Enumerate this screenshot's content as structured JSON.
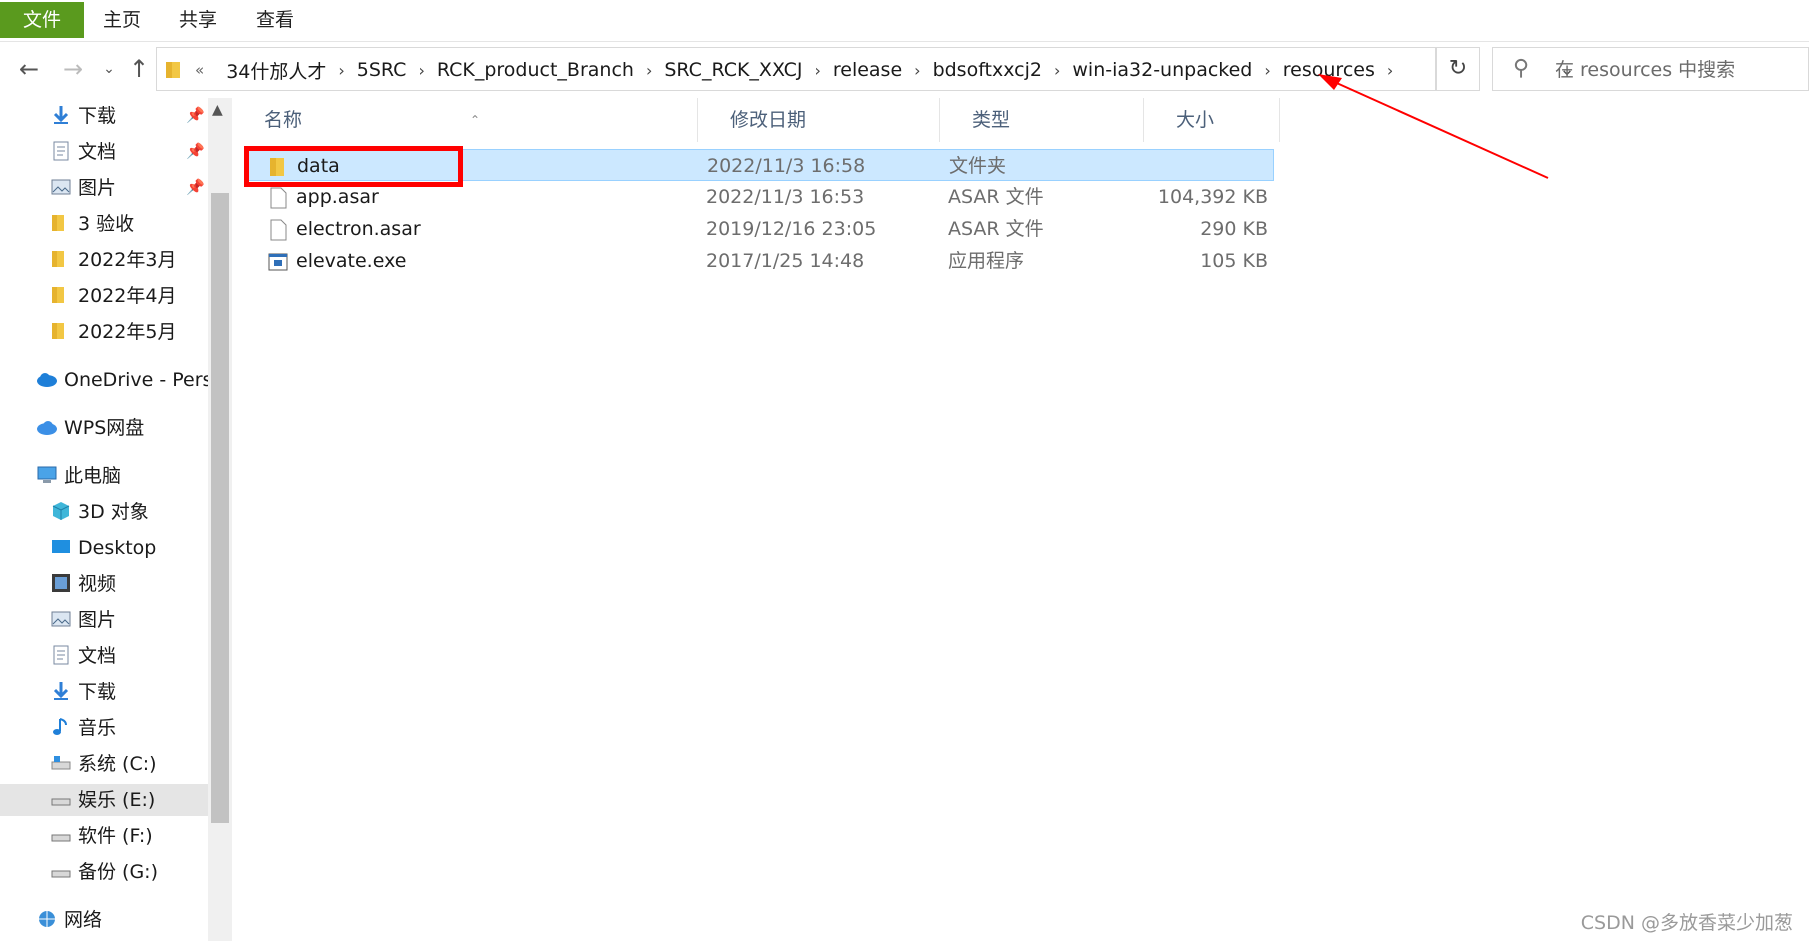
{
  "ribbon": {
    "tabs": [
      {
        "label": "文件"
      },
      {
        "label": "主页"
      },
      {
        "label": "共享"
      },
      {
        "label": "查看"
      }
    ]
  },
  "address": {
    "overflow": "«",
    "crumbs": [
      "34什邡人才",
      "5SRC",
      "RCK_product_Branch",
      "SRC_RCK_XXCJ",
      "release",
      "bdsoftxxcj2",
      "win-ia32-unpacked",
      "resources"
    ],
    "search_placeholder": "在 resources 中搜索"
  },
  "sidebar": {
    "quick": [
      {
        "label": "下载",
        "icon": "download-icon",
        "pinned": true
      },
      {
        "label": "文档",
        "icon": "documents-icon",
        "pinned": true
      },
      {
        "label": "图片",
        "icon": "pictures-icon",
        "pinned": true
      },
      {
        "label": "3 验收",
        "icon": "folder-icon"
      },
      {
        "label": "2022年3月",
        "icon": "folder-icon"
      },
      {
        "label": "2022年4月",
        "icon": "folder-icon"
      },
      {
        "label": "2022年5月",
        "icon": "folder-icon"
      }
    ],
    "onedrive": "OneDrive - Persc",
    "wps": "WPS网盘",
    "pc": "此电脑",
    "pc_items": [
      {
        "label": "3D 对象",
        "icon": "3d-objects-icon"
      },
      {
        "label": "Desktop",
        "icon": "desktop-icon"
      },
      {
        "label": "视频",
        "icon": "videos-icon"
      },
      {
        "label": "图片",
        "icon": "pictures-icon"
      },
      {
        "label": "文档",
        "icon": "documents-icon"
      },
      {
        "label": "下载",
        "icon": "download-icon"
      },
      {
        "label": "音乐",
        "icon": "music-icon"
      },
      {
        "label": "系统 (C:)",
        "icon": "system-drive-icon"
      },
      {
        "label": "娱乐 (E:)",
        "icon": "drive-icon",
        "selected": true
      },
      {
        "label": "软件 (F:)",
        "icon": "drive-icon"
      },
      {
        "label": "备份 (G:)",
        "icon": "drive-icon"
      }
    ],
    "network": "网络"
  },
  "list": {
    "headers": {
      "name": "名称",
      "date": "修改日期",
      "type": "类型",
      "size": "大小"
    },
    "rows": [
      {
        "name": "data",
        "date": "2022/11/3 16:58",
        "type": "文件夹",
        "size": "",
        "icon": "folder-icon",
        "selected": true
      },
      {
        "name": "app.asar",
        "date": "2022/11/3 16:53",
        "type": "ASAR 文件",
        "size": "104,392 KB",
        "icon": "file-icon"
      },
      {
        "name": "electron.asar",
        "date": "2019/12/16 23:05",
        "type": "ASAR 文件",
        "size": "290 KB",
        "icon": "file-icon"
      },
      {
        "name": "elevate.exe",
        "date": "2017/1/25 14:48",
        "type": "应用程序",
        "size": "105 KB",
        "icon": "exe-icon"
      }
    ]
  },
  "colors": {
    "file_tab": "#5a9a1e",
    "selection": "#cce8ff",
    "annotation": "#ff0000"
  },
  "watermark": "CSDN @多放香菜少加葱"
}
